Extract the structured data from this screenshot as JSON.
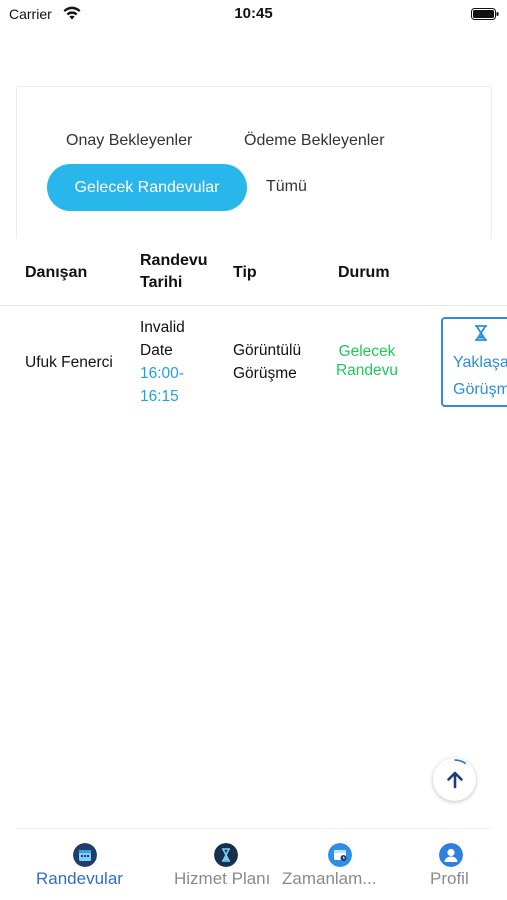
{
  "status_bar": {
    "carrier": "Carrier",
    "time": "10:45",
    "wifi_icon": "wifi-icon",
    "battery_icon": "battery-icon"
  },
  "filters": {
    "tabs": [
      {
        "label": "Onay Bekleyenler",
        "active": false
      },
      {
        "label": "Ödeme Bekleyenler",
        "active": false
      },
      {
        "label": "Gelecek Randevular",
        "active": true
      },
      {
        "label": "Tümü",
        "active": false
      }
    ],
    "active_color": "#29b6ea"
  },
  "table": {
    "headers": [
      "Danışan",
      "Randevu Tarihi",
      "Tip",
      "Durum"
    ],
    "rows": [
      {
        "client": "Ufuk Fenerci",
        "date": "Invalid Date",
        "time": "16:00-16:15",
        "type": "Görüntülü Görüşme",
        "status": "Gelecek Randevu",
        "status_color": "#1ec95c",
        "action_label": "Yaklaşan Görüşme",
        "action_icon": "hourglass-icon"
      }
    ]
  },
  "scroll_top_icon": "arrow-up-icon",
  "bottom_nav": {
    "items": [
      {
        "label": "Randevular",
        "icon": "calendar-icon",
        "active": true
      },
      {
        "label": "Hizmet Planı",
        "icon": "hourglass-icon",
        "active": false
      },
      {
        "label": "Zamanlam...",
        "icon": "schedule-icon",
        "active": false
      },
      {
        "label": "Profil",
        "icon": "profile-icon",
        "active": false
      }
    ],
    "active_color": "#2f6fc6"
  }
}
